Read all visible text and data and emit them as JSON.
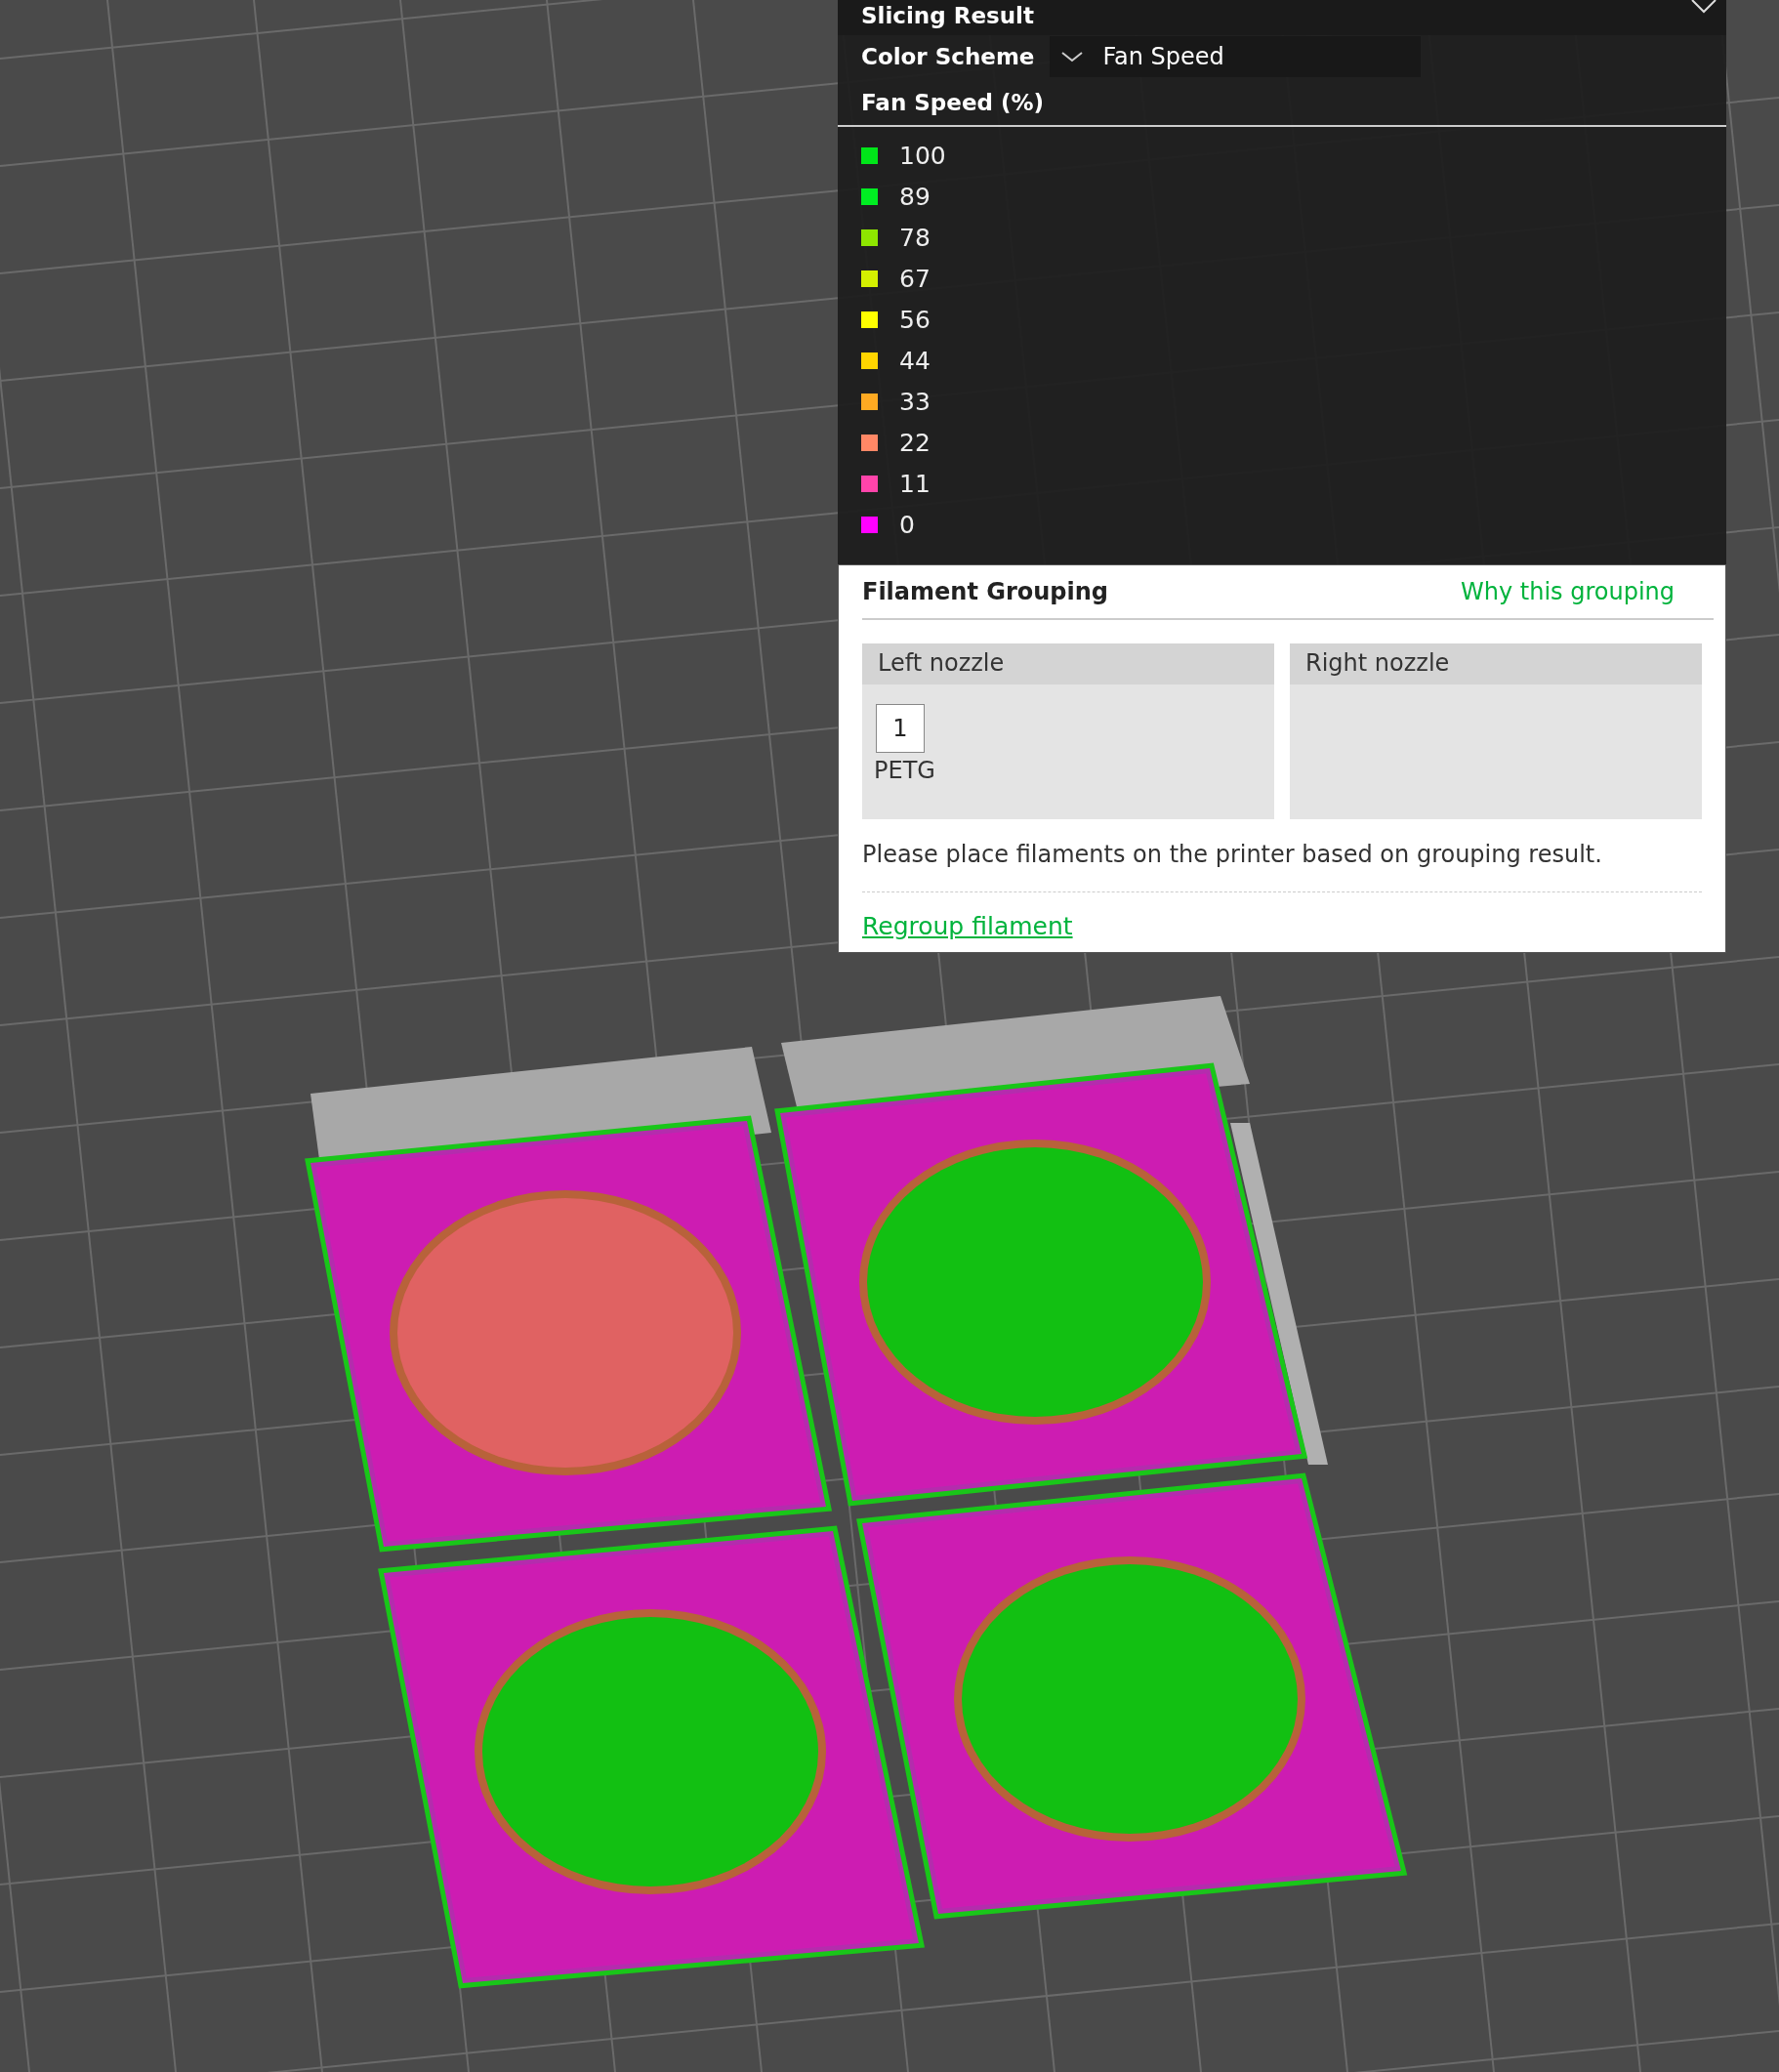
{
  "panel": {
    "title": "Slicing Result",
    "color_scheme": {
      "label": "Color Scheme",
      "value": "Fan Speed"
    }
  },
  "legend": {
    "title": "Fan Speed (%)",
    "items": [
      {
        "label": "100",
        "color": "#00e619"
      },
      {
        "label": "89",
        "color": "#00ee22"
      },
      {
        "label": "78",
        "color": "#8ee600"
      },
      {
        "label": "67",
        "color": "#d4f000"
      },
      {
        "label": "56",
        "color": "#ffff00"
      },
      {
        "label": "44",
        "color": "#ffd500"
      },
      {
        "label": "33",
        "color": "#ffaa22"
      },
      {
        "label": "22",
        "color": "#ff8866"
      },
      {
        "label": "11",
        "color": "#ff44aa"
      },
      {
        "label": "0",
        "color": "#ff00ff"
      }
    ]
  },
  "filament_grouping": {
    "title": "Filament Grouping",
    "link": "Why this grouping",
    "nozzles": [
      {
        "label": "Left nozzle",
        "filaments": [
          {
            "number": "1",
            "name": "PETG"
          }
        ]
      },
      {
        "label": "Right nozzle"
      }
    ],
    "note": "Please place filaments on the printer based on grouping result.",
    "action": "Regroup filament"
  }
}
